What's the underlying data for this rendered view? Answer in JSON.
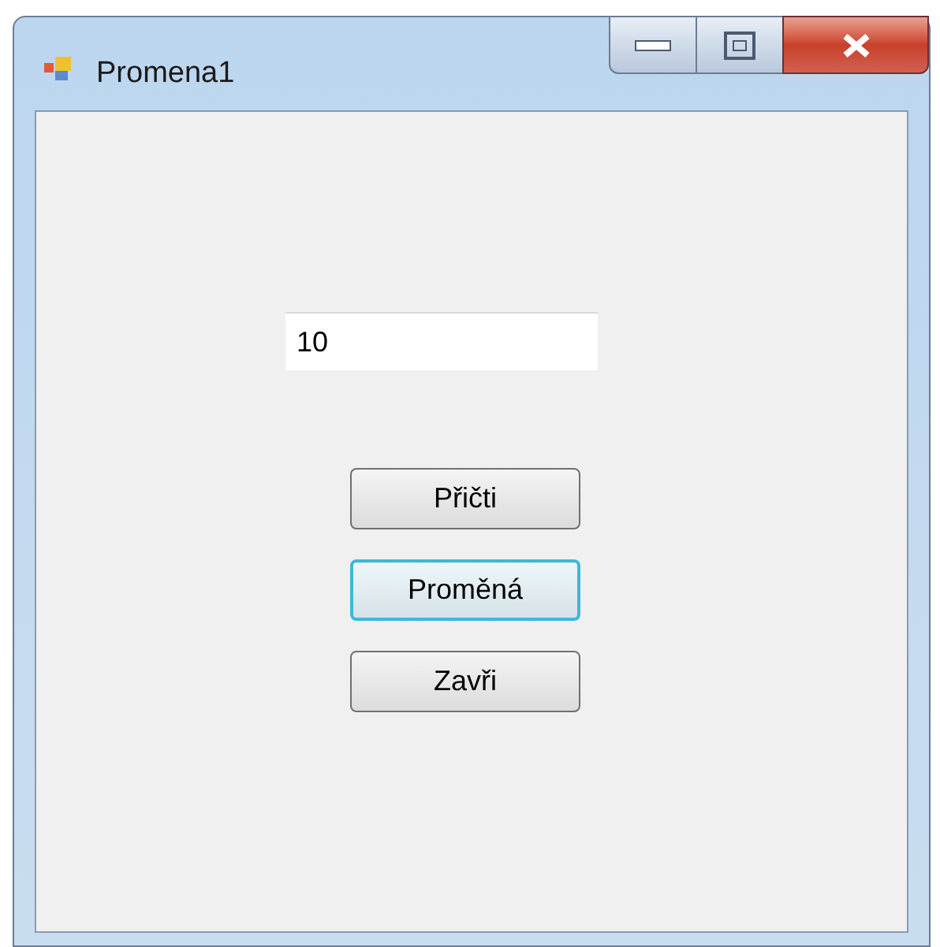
{
  "window": {
    "title": "Promena1"
  },
  "text_field": {
    "value": "10"
  },
  "buttons": [
    {
      "label": "Přičti",
      "focused": false
    },
    {
      "label": "Proměná",
      "focused": true
    },
    {
      "label": "Zavři",
      "focused": false
    }
  ]
}
